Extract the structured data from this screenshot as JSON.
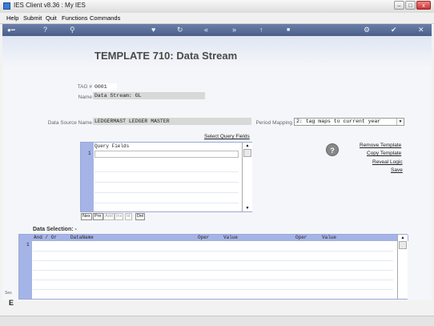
{
  "window": {
    "title": "IES Client v8.36 : My IES",
    "controls": {
      "minimize": "–",
      "maximize": "□",
      "close": "x"
    }
  },
  "menu": [
    "Help",
    "Submit",
    "Quit",
    "Functions",
    "Commands"
  ],
  "toolbar": {
    "icons": [
      "key-icon",
      "help-icon",
      "search-icon",
      "heart-icon",
      "refresh-icon",
      "back-icon",
      "forward-icon",
      "upload-icon",
      "stop-icon",
      "settings-icon",
      "ok-icon",
      "close-icon"
    ]
  },
  "page": {
    "heading": "TEMPLATE 710: Data Stream",
    "tag_label": "TAG #",
    "tag_value": "0001",
    "name_label": "Name",
    "name_value": "Data Stream: GL",
    "datasource_label": "Data Source Name",
    "datasource_value": "LEDGERMAST LEDGER MASTER",
    "period_label": "Period Mapping",
    "period_value": "2: tag maps to current year",
    "select_query_fields": "Select Query Fields",
    "help_glyph": "?",
    "actions": [
      "Remove Template",
      "Copy Template",
      "Reveal Logic",
      "Save"
    ]
  },
  "query_grid": {
    "header": "Query Fields",
    "row_number": "1",
    "buttons": [
      {
        "label": "Nex",
        "enabled": true
      },
      {
        "label": "Pre",
        "enabled": true
      },
      {
        "label": "Add",
        "enabled": false
      },
      {
        "label": "Ins",
        "enabled": false
      },
      {
        "label": "Id",
        "enabled": false
      },
      {
        "label": "Del",
        "enabled": true
      }
    ]
  },
  "data_selection": {
    "title": "Data Selection: -",
    "columns": [
      "And / Or",
      "DataName",
      "Oper",
      "Value",
      "Oper",
      "Value"
    ],
    "row_number": "1"
  },
  "side": {
    "label_top": "Ses",
    "label_bottom": "E"
  }
}
